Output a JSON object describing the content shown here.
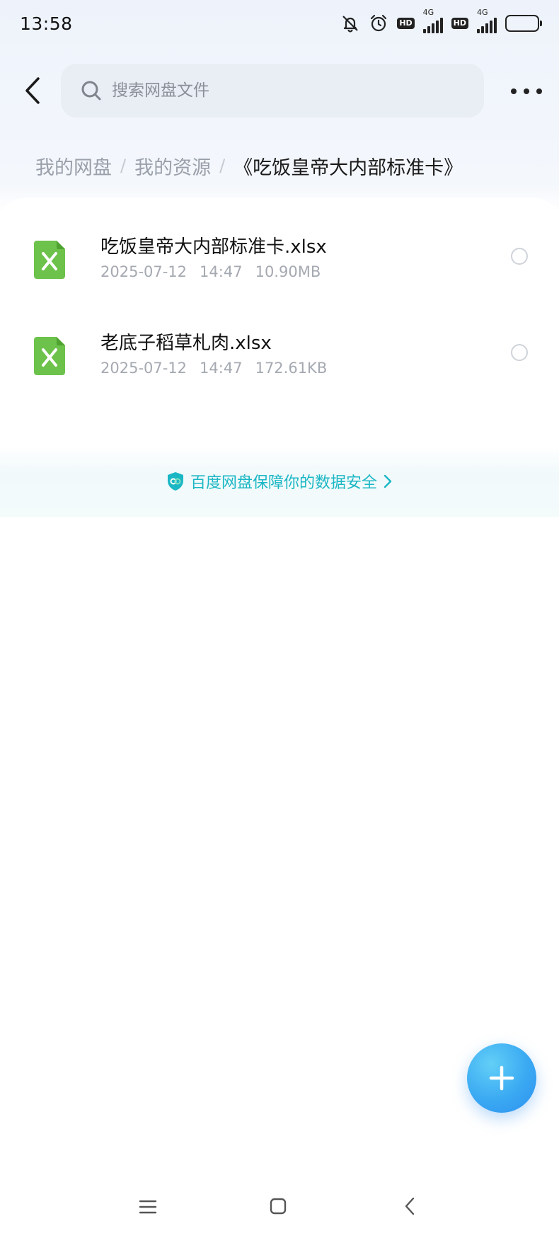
{
  "status_bar": {
    "time": "13:58",
    "network_1": {
      "badge": "HD",
      "type": "4G"
    },
    "network_2": {
      "badge": "HD",
      "type": "4G"
    },
    "icons": [
      "bell-off-icon",
      "alarm-icon",
      "signal-icon",
      "battery-icon"
    ]
  },
  "header": {
    "search_placeholder": "搜索网盘文件"
  },
  "breadcrumb": {
    "items": [
      "我的网盘",
      "我的资源"
    ],
    "current": "《吃饭皇帝大内部标准卡》"
  },
  "files": [
    {
      "name": "吃饭皇帝大内部标准卡.xlsx",
      "date": "2025-07-12",
      "time": "14:47",
      "size": "10.90MB",
      "icon": "excel-file-icon"
    },
    {
      "name": "老底子稻草札肉.xlsx",
      "date": "2025-07-12",
      "time": "14:47",
      "size": "172.61KB",
      "icon": "excel-file-icon"
    }
  ],
  "safety_notice": {
    "text": "百度网盘保障你的数据安全",
    "color": "#1bb7c4"
  },
  "colors": {
    "accent": "#3aa9f2",
    "excel_green": "#6cc24a"
  }
}
